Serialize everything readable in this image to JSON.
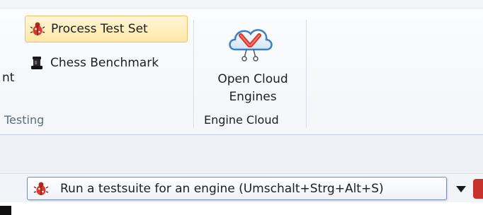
{
  "ribbon": {
    "process_test_set": {
      "label": "Process Test Set",
      "icon": "bug-icon"
    },
    "chess_benchmark": {
      "label": "Chess Benchmark",
      "icon": "chess-piece-icon"
    },
    "cut_off_label": "nt",
    "testing_group_label": "Testing",
    "open_cloud_engines": {
      "label_line1": "Open Cloud",
      "label_line2": "Engines",
      "icon": "cloud-engines-icon"
    },
    "engine_cloud_group_label": "Engine Cloud"
  },
  "tooltip": {
    "icon": "bug-icon",
    "text": "Run a testsuite for an engine (Umschalt+Strg+Alt+S)"
  },
  "toolbar": {
    "dropdown_icon": "triangle-down-icon"
  },
  "colors": {
    "highlight_fill": "#ffe8a6",
    "highlight_border": "#f1c15f",
    "icon_red": "#d73a2f"
  }
}
